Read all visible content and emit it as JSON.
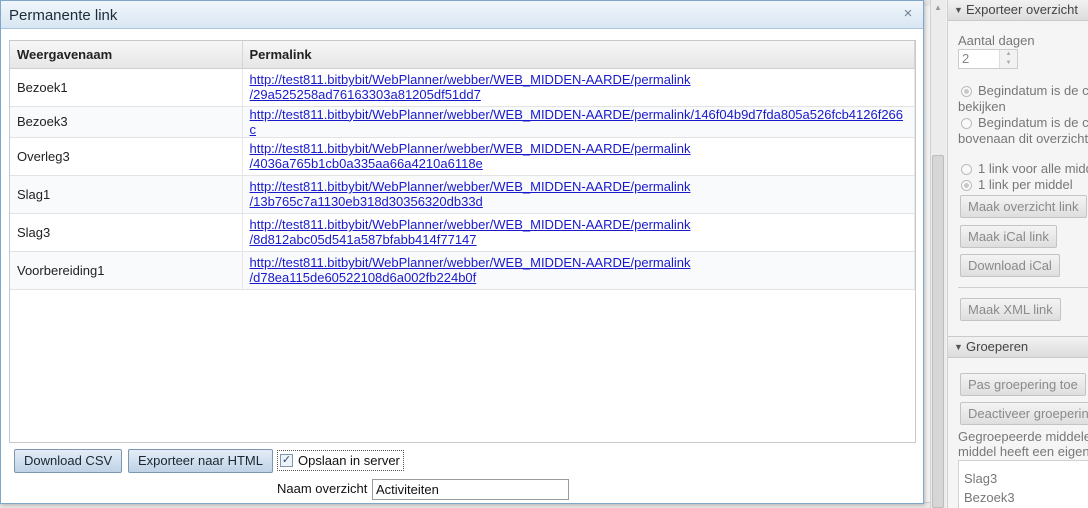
{
  "dialog": {
    "title": "Permanente link",
    "close_glyph": "×",
    "table": {
      "headers": [
        "Weergavenaam",
        "Permalink"
      ],
      "rows": [
        {
          "name": "Bezoek1",
          "link1": "http://test811.bitbybit/WebPlanner/webber/WEB_MIDDEN-AARDE/permalink",
          "link2": "/29a525258ad76163303a81205df51dd7"
        },
        {
          "name": "Bezoek3",
          "link1": "http://test811.bitbybit/WebPlanner/webber/WEB_MIDDEN-AARDE/permalink/146f04b9d7fda805a526fcb4126f266c",
          "link2": ""
        },
        {
          "name": "Overleg3",
          "link1": "http://test811.bitbybit/WebPlanner/webber/WEB_MIDDEN-AARDE/permalink",
          "link2": "/4036a765b1cb0a335aa66a4210a6118e"
        },
        {
          "name": "Slag1",
          "link1": "http://test811.bitbybit/WebPlanner/webber/WEB_MIDDEN-AARDE/permalink",
          "link2": "/13b765c7a1130eb318d30356320db33d"
        },
        {
          "name": "Slag3",
          "link1": "http://test811.bitbybit/WebPlanner/webber/WEB_MIDDEN-AARDE/permalink",
          "link2": "/8d812abc05d541a587bfabb414f77147"
        },
        {
          "name": "Voorbereiding1",
          "link1": "http://test811.bitbybit/WebPlanner/webber/WEB_MIDDEN-AARDE/permalink",
          "link2": "/d78ea115de60522108d6a002fb224b0f"
        }
      ]
    },
    "buttons": {
      "download_csv": "Download CSV",
      "export_html": "Exporteer naar HTML"
    },
    "save_on_server": {
      "label": "Opslaan in server",
      "checked": true,
      "check_glyph": "✓"
    },
    "overview_name": {
      "label": "Naam overzicht",
      "value": "Activiteiten"
    }
  },
  "right_panel": {
    "export_section": {
      "header": "Exporteer overzicht",
      "days_label": "Aantal dagen",
      "days_value": "2",
      "radio1_line1": "Begindatum is de c",
      "radio1_line2": "bekijken",
      "radio2_line1": "Begindatum is de c",
      "radio2_line2": "bovenaan dit overzicht",
      "radio3": "1 link voor alle midde",
      "radio4": "1 link per middel",
      "btn_overview_link": "Maak overzicht link",
      "btn_ical_link": "Maak iCal link",
      "btn_download_ical": "Download iCal",
      "btn_xml_link": "Maak XML link"
    },
    "group_section": {
      "header": "Groeperen",
      "btn_apply": "Pas groepering toe",
      "btn_deactivate": "Deactiveer groeperin",
      "desc_line1": "Gegroepeerde middele",
      "desc_line2": "middel heeft een eigen",
      "items": [
        "Slag3",
        "Bezoek3"
      ]
    }
  },
  "colors": {
    "titlebar": "#d8e6f3",
    "link": "#1a1acc",
    "button": "#bfd2e6"
  }
}
